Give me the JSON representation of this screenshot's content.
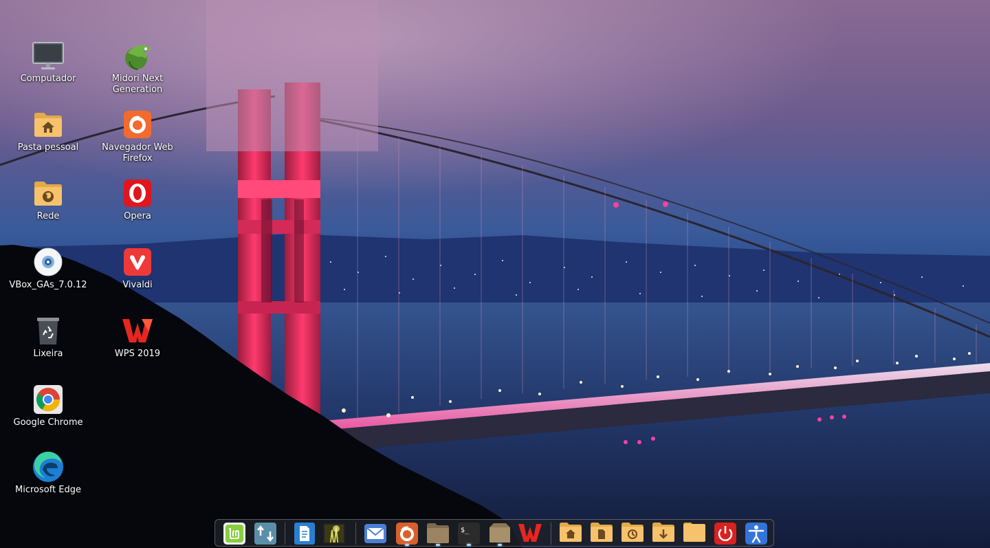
{
  "desktop": {
    "icons_left": [
      {
        "label": "Computador",
        "icon": "computer-icon"
      },
      {
        "label": "Pasta pessoal",
        "icon": "home-folder-icon"
      },
      {
        "label": "Rede",
        "icon": "network-folder-icon"
      },
      {
        "label": "VBox_GAs_7.0.12",
        "icon": "disc-icon"
      },
      {
        "label": "Lixeira",
        "icon": "trash-icon"
      },
      {
        "label": "Google Chrome",
        "icon": "chrome-icon"
      },
      {
        "label": "Microsoft Edge",
        "icon": "edge-icon"
      }
    ],
    "icons_right": [
      {
        "label": "Midori Next Generation",
        "icon": "midori-icon"
      },
      {
        "label": "Navegador Web Firefox",
        "icon": "firefox-icon"
      },
      {
        "label": "Opera",
        "icon": "opera-icon"
      },
      {
        "label": "Vivaldi",
        "icon": "vivaldi-icon"
      },
      {
        "label": "WPS 2019",
        "icon": "wps-icon"
      }
    ]
  },
  "dock": {
    "items": [
      {
        "name": "linux-mint-menu-icon",
        "running": false
      },
      {
        "name": "update-manager-icon",
        "running": false
      },
      {
        "name": "text-editor-icon",
        "running": false
      },
      {
        "name": "image-viewer-icon",
        "running": false
      },
      {
        "name": "mail-icon",
        "running": false
      },
      {
        "name": "firefox-dock-icon",
        "running": true
      },
      {
        "name": "files-dock-icon",
        "running": true
      },
      {
        "name": "terminal-icon",
        "running": true
      },
      {
        "name": "archive-manager-icon",
        "running": true
      },
      {
        "name": "wps-dock-icon",
        "running": false
      },
      {
        "name": "home-folder-dock-icon",
        "running": false
      },
      {
        "name": "documents-folder-icon",
        "running": false
      },
      {
        "name": "recent-folder-icon",
        "running": false
      },
      {
        "name": "downloads-folder-icon",
        "running": false
      },
      {
        "name": "folder-dock-icon",
        "running": false
      },
      {
        "name": "power-icon",
        "running": false
      },
      {
        "name": "accessibility-icon",
        "running": false
      }
    ]
  },
  "colors": {
    "folder": "#f6c26b",
    "folder_dark": "#e3a94a",
    "bridge_red": "#ff2e63",
    "dock_bg": "#1e2128",
    "mint_green": "#87cf3e"
  }
}
